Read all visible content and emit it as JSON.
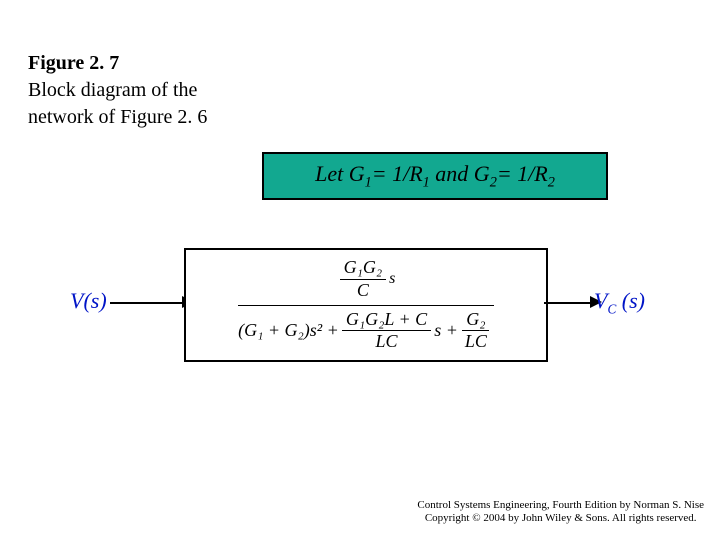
{
  "caption": {
    "title": "Figure 2. 7",
    "line1": "Block diagram of the",
    "line2": "network of Figure 2. 6"
  },
  "letbox": {
    "prefix": "Let G",
    "g1sub": "1",
    "eq1": "= 1/R",
    "r1sub": "1",
    "mid": " and G",
    "g2sub": "2",
    "eq2": "= 1/R",
    "r2sub": "2"
  },
  "io": {
    "input": "V(s)",
    "output_pre": "V",
    "output_sub": "C",
    "output_post": " (s)"
  },
  "tf": {
    "num_frac_top": "G₁G₂",
    "num_frac_bot": "C",
    "num_tail": " s",
    "den_lead": "(G₁ + G₂)s² + ",
    "den_mid_top": "G₁G₂L + C",
    "den_mid_bot": "LC",
    "den_mid_tail": " s + ",
    "den_end_top": "G₂",
    "den_end_bot": "LC"
  },
  "credit": {
    "line1": "Control Systems Engineering, Fourth Edition by Norman S. Nise",
    "line2": "Copyright © 2004 by John Wiley & Sons. All rights reserved."
  }
}
